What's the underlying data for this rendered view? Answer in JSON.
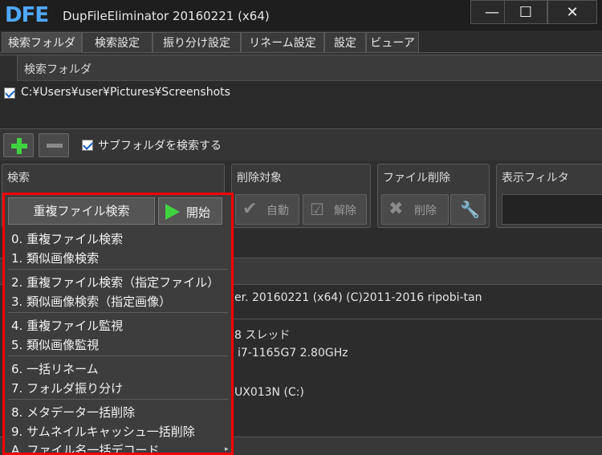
{
  "window": {
    "logo": "DFE",
    "title": "DupFileEliminator 20160221 (x64)",
    "minimize": "—",
    "maximize": "☐",
    "close": "✕"
  },
  "tabs": [
    "検索フォルダ",
    "検索設定",
    "振り分け設定",
    "リネーム設定",
    "設定",
    "ビューア"
  ],
  "folders": {
    "header": "検索フォルダ",
    "items": [
      "C:¥Users¥user¥Pictures¥Screenshots"
    ]
  },
  "toolbar": {
    "subfolder_label": "サブフォルダを検索する"
  },
  "groups": {
    "search": {
      "title": "検索"
    },
    "delete_target": {
      "title": "削除対象",
      "auto": "自動",
      "release": "解除"
    },
    "file_delete": {
      "title": "ファイル削除",
      "delete": "削除"
    },
    "display_filter": {
      "title": "表示フィルタ"
    }
  },
  "log": {
    "lines": [
      "er. 20160221 (x64) (C)2011-2016 ripobi-tan",
      "8 スレッド",
      "i7-1165G7 2.80GHz",
      "UX013N (C:)"
    ]
  },
  "menu": {
    "dup_search": "重複ファイル検索",
    "start": "開始",
    "items": [
      "0. 重複ファイル検索",
      "1. 類似画像検索",
      "2. 重複ファイル検索（指定ファイル）",
      "3. 類似画像検索（指定画像）",
      "4. 重複ファイル監視",
      "5. 類似画像監視",
      "6. 一括リネーム",
      "7. フォルダ振り分け",
      "8. メタデータ一括削除",
      "9. サムネイルキャッシュ一括削除",
      "A. ファイル名一括デコード"
    ]
  },
  "colors": {
    "highlight_border": "#ff0000",
    "accent_green": "#3fd43f",
    "logo_blue": "#4fa8ff"
  }
}
